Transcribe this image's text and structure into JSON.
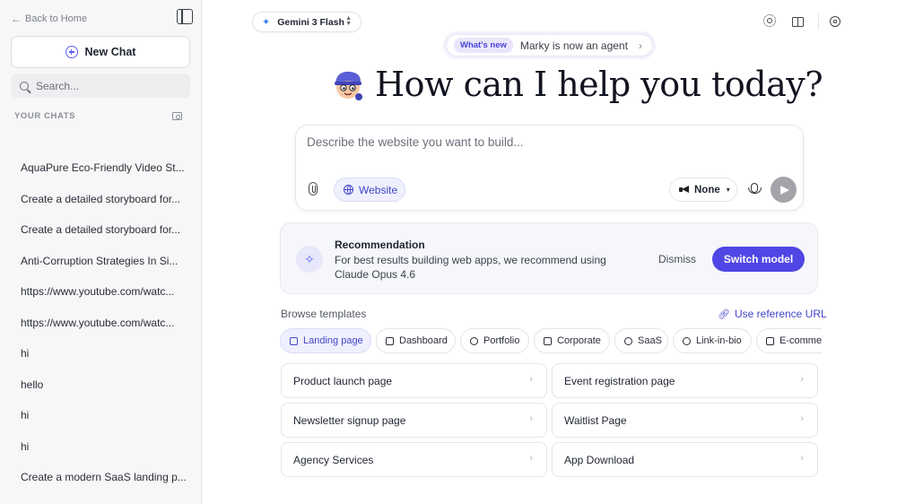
{
  "sidebar": {
    "back_label": "Back to Home",
    "new_chat_label": "New Chat",
    "search_placeholder": "Search...",
    "section_title": "YOUR CHATS",
    "chats": [
      "AquaPure Eco-Friendly Video St...",
      "Create a detailed storyboard for...",
      "Create a detailed storyboard for...",
      "Anti-Corruption Strategies In Si...",
      "https://www.youtube.com/watc...",
      "https://www.youtube.com/watc...",
      "hi",
      "hello",
      "hi",
      "hi",
      "Create a modern SaaS landing p..."
    ]
  },
  "header": {
    "model_label": "Gemini 3 Flash",
    "announce_badge": "What's new",
    "announce_text": "Marky is now an agent"
  },
  "hero": {
    "title": "How can I help you today?"
  },
  "prompt": {
    "placeholder": "Describe the website you want to build...",
    "mode_label": "Website",
    "style_label": "None"
  },
  "recommendation": {
    "title": "Recommendation",
    "body": "For best results building web apps, we recommend using Claude Opus 4.6",
    "dismiss_label": "Dismiss",
    "switch_label": "Switch model"
  },
  "templates": {
    "browse_label": "Browse templates",
    "ref_url_label": "Use reference URL",
    "categories": [
      "Landing page",
      "Dashboard",
      "Portfolio",
      "Corporate",
      "SaaS",
      "Link-in-bio",
      "E-commerce"
    ],
    "items": [
      "Product launch page",
      "Event registration page",
      "Newsletter signup page",
      "Waitlist Page",
      "Agency Services",
      "App Download"
    ]
  },
  "colors": {
    "accent": "#4f46e5",
    "accent_soft": "#eef0fd",
    "sidebar_bg": "#f7f7f8"
  }
}
